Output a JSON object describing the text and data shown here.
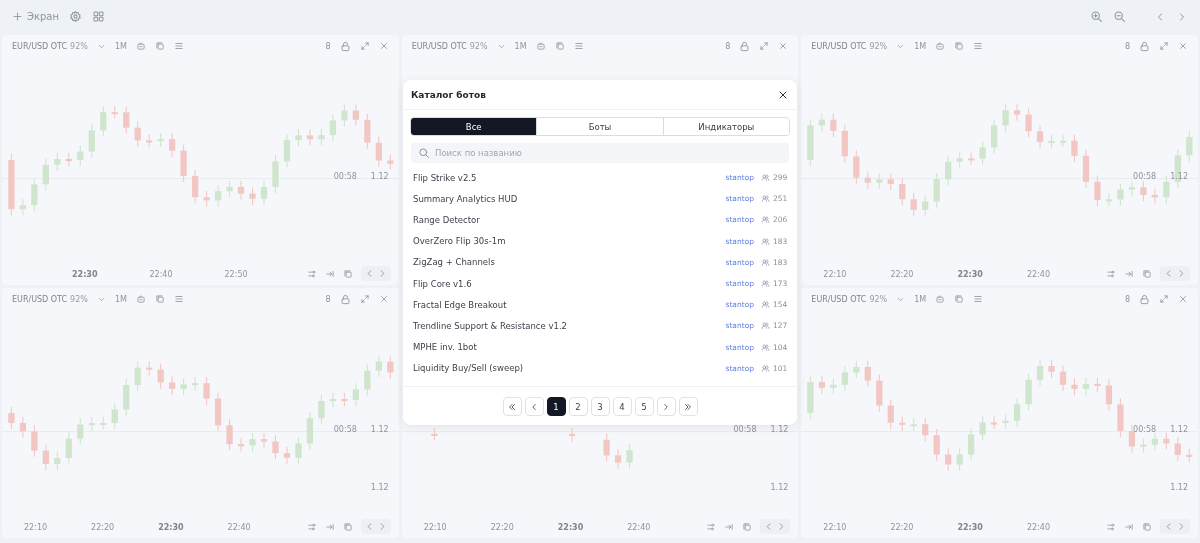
{
  "toolbar": {
    "add_label": "Экран"
  },
  "panels": [
    {
      "symbol": "EUR/USD OTC",
      "payout": "92%",
      "timeframe": "1M",
      "count": "8",
      "price_labels": [
        "00:58",
        "1.12"
      ],
      "time_labels": [
        {
          "text": "22:30",
          "bold": true
        },
        {
          "text": "22:40",
          "bold": false
        },
        {
          "text": "22:50",
          "bold": false
        }
      ]
    },
    {
      "symbol": "EUR/USD OTC",
      "payout": "92%",
      "timeframe": "1M",
      "count": "8"
    },
    {
      "symbol": "EUR/USD OTC",
      "payout": "92%",
      "timeframe": "1M",
      "count": "8",
      "price_labels": [
        "00:58",
        "1.12"
      ],
      "time_labels": [
        {
          "text": "22:10",
          "bold": false
        },
        {
          "text": "22:20",
          "bold": false
        },
        {
          "text": "22:30",
          "bold": true
        },
        {
          "text": "22:40",
          "bold": false
        }
      ]
    },
    {
      "symbol": "EUR/USD OTC",
      "payout": "92%",
      "timeframe": "1M",
      "count": "8",
      "price_labels": [
        "00:58",
        "1.12"
      ],
      "corner_label": "1.12",
      "time_labels": [
        {
          "text": "22:10",
          "bold": false
        },
        {
          "text": "22:20",
          "bold": false
        },
        {
          "text": "22:30",
          "bold": true
        },
        {
          "text": "22:40",
          "bold": false
        }
      ]
    },
    {
      "price_labels": [
        "00:58",
        "1.12"
      ],
      "corner_label": "1.12",
      "time_labels": [
        {
          "text": "22:10",
          "bold": false
        },
        {
          "text": "22:20",
          "bold": false
        },
        {
          "text": "22:30",
          "bold": true
        },
        {
          "text": "22:40",
          "bold": false
        }
      ]
    },
    {
      "symbol": "EUR/USD OTC",
      "payout": "92%",
      "timeframe": "1M",
      "count": "8",
      "price_labels": [
        "00:58",
        "1.12"
      ],
      "corner_label": "1.12",
      "time_labels": [
        {
          "text": "22:10",
          "bold": false
        },
        {
          "text": "22:20",
          "bold": false
        },
        {
          "text": "22:30",
          "bold": true
        },
        {
          "text": "22:40",
          "bold": false
        }
      ]
    }
  ],
  "modal": {
    "title": "Каталог ботов",
    "tabs": [
      {
        "label": "Все",
        "selected": true
      },
      {
        "label": "Боты",
        "selected": false
      },
      {
        "label": "Индикаторы",
        "selected": false
      }
    ],
    "search": {
      "placeholder": "Поиск по названию"
    },
    "items": [
      {
        "name": "Flip Strike v2.5",
        "author": "stantop",
        "users": "299"
      },
      {
        "name": "Summary Analytics HUD",
        "author": "stantop",
        "users": "251"
      },
      {
        "name": "Range Detector",
        "author": "stantop",
        "users": "206"
      },
      {
        "name": "OverZero Flip 30s-1m",
        "author": "stantop",
        "users": "183"
      },
      {
        "name": "ZigZag + Channels",
        "author": "stantop",
        "users": "183"
      },
      {
        "name": "Flip Core v1.6",
        "author": "stantop",
        "users": "173"
      },
      {
        "name": "Fractal Edge Breakout",
        "author": "stantop",
        "users": "154"
      },
      {
        "name": "Trendline Support & Resistance v1.2",
        "author": "stantop",
        "users": "127"
      },
      {
        "name": "MPHE inv. 1bot",
        "author": "stantop",
        "users": "104"
      },
      {
        "name": "Liquidity Buy/Sell (sweep)",
        "author": "stantop",
        "users": "101"
      }
    ],
    "pages": [
      {
        "label": "1",
        "selected": true
      },
      {
        "label": "2",
        "selected": false
      },
      {
        "label": "3",
        "selected": false
      },
      {
        "label": "4",
        "selected": false
      },
      {
        "label": "5",
        "selected": false
      }
    ]
  }
}
